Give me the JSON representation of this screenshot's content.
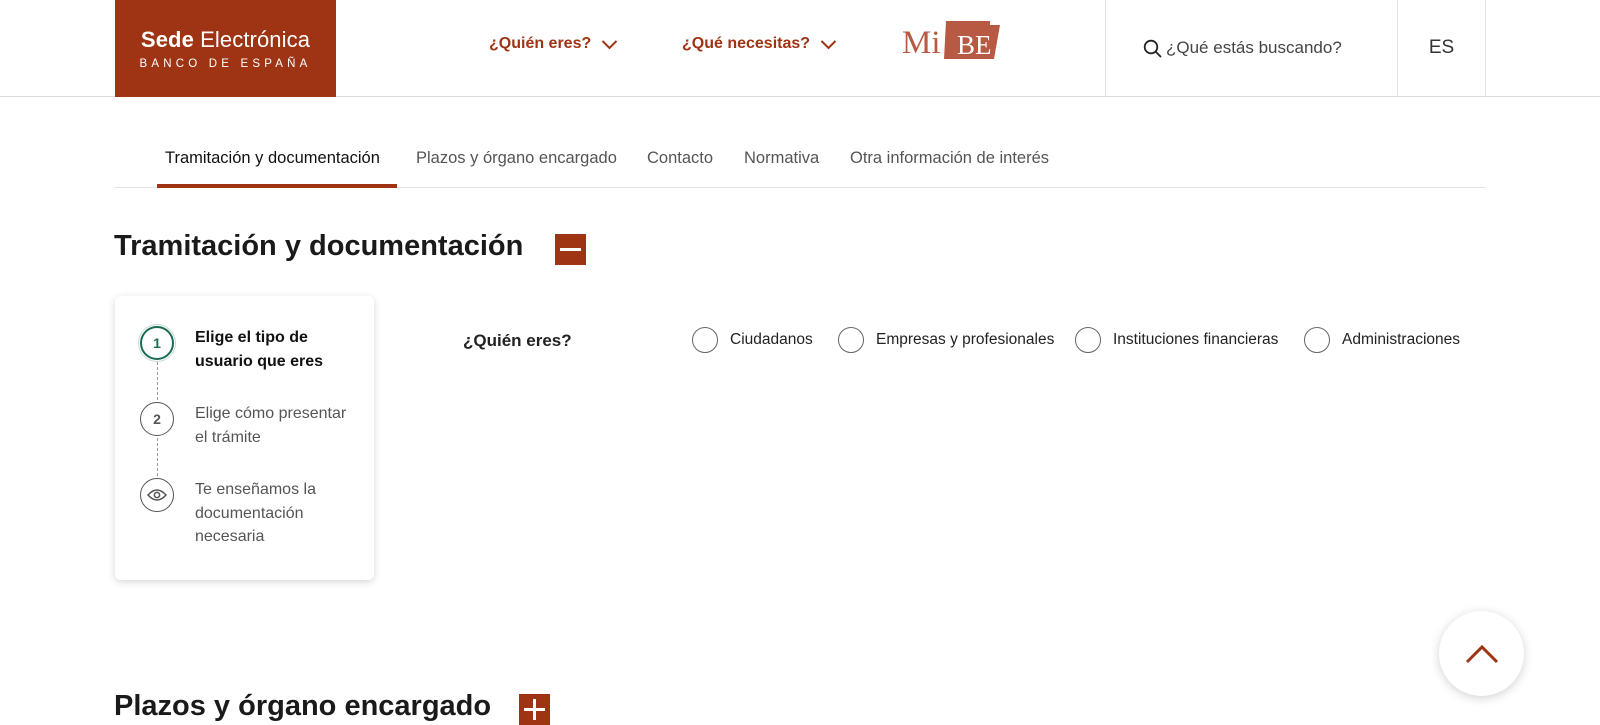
{
  "header": {
    "logo_main_bold": "Sede",
    "logo_main_rest": " Electrónica",
    "logo_sub": "BANCO DE ESPAÑA",
    "nav_quien": "¿Quién eres?",
    "nav_que": "¿Qué necesitas?",
    "mibe_mi": "Mi",
    "mibe_be": "BE",
    "search_placeholder": "¿Qué estás buscando?",
    "language": "ES"
  },
  "tabs": [
    {
      "label": "Tramitación y documentación",
      "active": true
    },
    {
      "label": "Plazos y órgano encargado",
      "active": false
    },
    {
      "label": "Contacto",
      "active": false
    },
    {
      "label": "Normativa",
      "active": false
    },
    {
      "label": "Otra información de interés",
      "active": false
    }
  ],
  "section1": {
    "title": "Tramitación y documentación",
    "expanded": true
  },
  "steps": [
    {
      "marker": "1",
      "label": "Elige el tipo de usuario que eres",
      "active": true
    },
    {
      "marker": "2",
      "label": "Elige cómo presentar el trámite",
      "active": false
    },
    {
      "marker": "eye-icon",
      "label": "Te enseñamos la documentación necesaria",
      "active": false
    }
  ],
  "question": {
    "label": "¿Quién eres?",
    "options": [
      "Ciudadanos",
      "Empresas y profesionales",
      "Instituciones financieras",
      "Administraciones"
    ]
  },
  "section2": {
    "title": "Plazos y órgano encargado",
    "expanded": false
  },
  "colors": {
    "brand": "#9e3414",
    "step_active": "#1b6b55"
  }
}
